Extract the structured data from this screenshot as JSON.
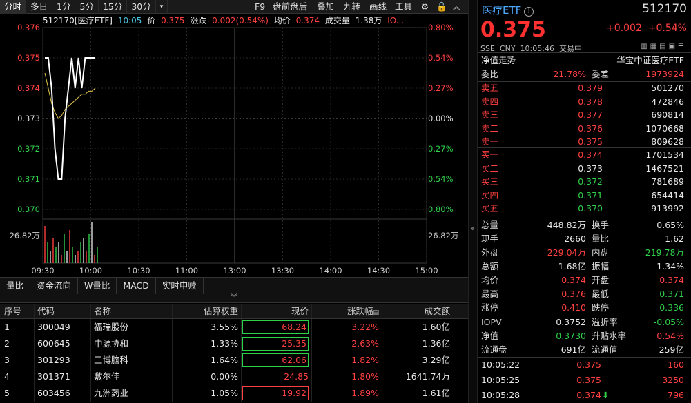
{
  "periods": [
    "分时",
    "多日",
    "1分",
    "5分",
    "15分",
    "30分"
  ],
  "toolbar": {
    "f9": "F9",
    "prepost": "盘前盘后",
    "overlay": "叠加",
    "nine": "九转",
    "draw": "画线",
    "tools": "工具"
  },
  "info": {
    "code": "512170[医疗ETF]",
    "time": "10:05",
    "price_label": "价",
    "price": "0.375",
    "chg_label": "涨跌",
    "chg": "0.002(0.54%)",
    "avg_label": "均价",
    "avg": "0.374",
    "vol_label": "成交量",
    "vol": "1.38万",
    "io": "IO..."
  },
  "chart_data": {
    "type": "line",
    "title": "",
    "x_ticks": [
      "09:30",
      "10:00",
      "10:30",
      "11:00",
      "13:00",
      "13:30",
      "14:00",
      "14:30",
      "15:00"
    ],
    "y_ticks": [
      "0.376",
      "0.375",
      "0.374",
      "0.373",
      "0.372",
      "0.371",
      "0.370"
    ],
    "pct_ticks": [
      "0.80%",
      "0.54%",
      "0.27%",
      "0.00%",
      "0.27%",
      "0.54%",
      "0.80%"
    ],
    "ylim": [
      0.37,
      0.376
    ],
    "prev_close": 0.373,
    "vol_label": "26.82万",
    "price_series": [
      0.375,
      0.375,
      0.374,
      0.372,
      0.371,
      0.371,
      0.373,
      0.374,
      0.375,
      0.374,
      0.375,
      0.374,
      0.375,
      0.375,
      0.375,
      0.375
    ],
    "avg_series": [
      0.3745,
      0.374,
      0.3735,
      0.3732,
      0.373,
      0.3731,
      0.3733,
      0.3734,
      0.3735,
      0.3736,
      0.3737,
      0.3738,
      0.3738,
      0.3739,
      0.3739,
      0.374
    ]
  },
  "indicator_tabs": [
    "量比",
    "资金流向",
    "W量比",
    "MACD",
    "实时申赎"
  ],
  "table": {
    "headers": [
      "序号",
      "代码",
      "名称",
      "估算权重",
      "现价",
      "涨跌幅",
      "成交额"
    ],
    "rows": [
      [
        "1",
        "300049",
        "福瑞股份",
        "3.55%",
        "68.24",
        "3.22%",
        "1.60亿"
      ],
      [
        "2",
        "600645",
        "中源协和",
        "1.33%",
        "25.35",
        "2.63%",
        "1.36亿"
      ],
      [
        "3",
        "301293",
        "三博脑科",
        "1.64%",
        "62.06",
        "1.82%",
        "3.29亿"
      ],
      [
        "4",
        "301371",
        "敷尔佳",
        "0.00%",
        "24.85",
        "1.80%",
        "1641.74万"
      ],
      [
        "5",
        "603456",
        "九洲药业",
        "1.05%",
        "19.92",
        "1.89%",
        "1.61亿"
      ]
    ]
  },
  "quote": {
    "name": "医疗ETF",
    "code": "512170",
    "price": "0.375",
    "chg": "+0.002",
    "pct": "+0.54%",
    "exch": "SSE",
    "cur": "CNY",
    "time": "10:05:46",
    "status": "交易中",
    "nav_label": "净值走势",
    "fund": "华宝中证医疗ETF",
    "wb_label": "委比",
    "wb": "21.78%",
    "wc_label": "委差",
    "wc": "1973924"
  },
  "asks": [
    [
      "卖五",
      "0.379",
      "501270"
    ],
    [
      "卖四",
      "0.378",
      "472846"
    ],
    [
      "卖三",
      "0.377",
      "690814"
    ],
    [
      "卖二",
      "0.376",
      "1070668"
    ],
    [
      "卖一",
      "0.375",
      "809628"
    ]
  ],
  "bids": [
    [
      "买一",
      "0.374",
      "1701534"
    ],
    [
      "买二",
      "0.373",
      "1467521"
    ],
    [
      "买三",
      "0.372",
      "781689"
    ],
    [
      "买四",
      "0.371",
      "654414"
    ],
    [
      "买五",
      "0.370",
      "913992"
    ]
  ],
  "stats": [
    [
      "总量",
      "448.82万",
      "换手",
      "0.65%"
    ],
    [
      "现手",
      "2660",
      "量比",
      "1.62"
    ],
    [
      "外盘",
      "229.04万",
      "内盘",
      "219.78万"
    ],
    [
      "总额",
      "1.68亿",
      "振幅",
      "1.34%"
    ],
    [
      "均价",
      "0.374",
      "开盘",
      "0.374"
    ],
    [
      "最高",
      "0.376",
      "最低",
      "0.371"
    ],
    [
      "涨停",
      "0.410",
      "跌停",
      "0.336"
    ]
  ],
  "etf": [
    [
      "IOPV",
      "0.3752",
      "溢折率",
      "-0.05%"
    ],
    [
      "净值",
      "0.3730",
      "升贴水率",
      "0.54%"
    ],
    [
      "流通盘",
      "691亿",
      "流通值",
      "259亿"
    ]
  ],
  "ticks": [
    [
      "10:05:22",
      "0.375",
      "160"
    ],
    [
      "10:05:25",
      "0.375",
      "3250"
    ],
    [
      "10:05:28",
      "0.374",
      "796"
    ]
  ]
}
